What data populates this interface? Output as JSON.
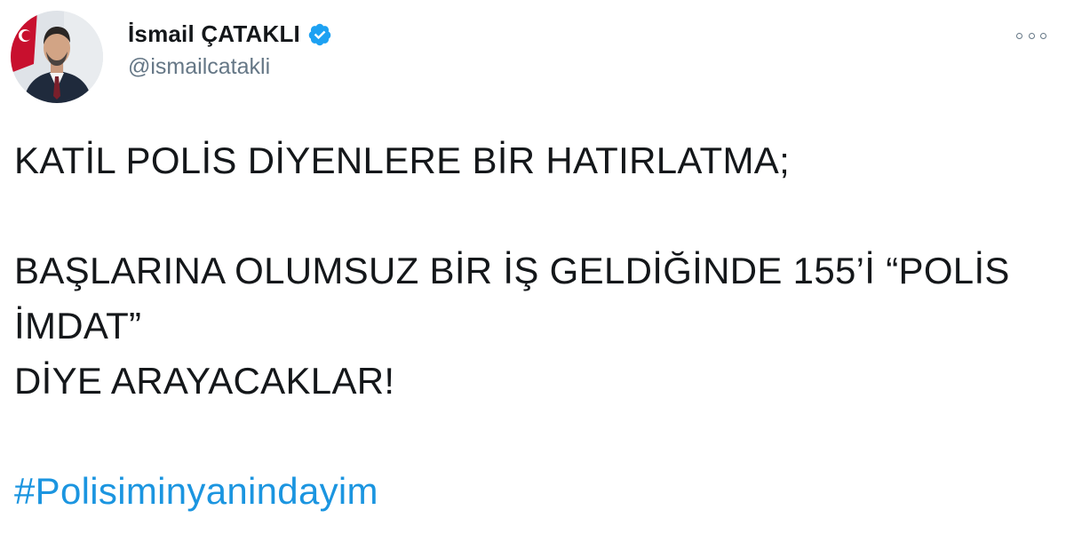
{
  "author": {
    "display_name": "İsmail ÇATAKLI",
    "handle": "@ismailcatakli",
    "verified": true,
    "avatar_icon": "profile-photo"
  },
  "tweet": {
    "lines": [
      "KATİL POLİS DİYENLERE BİR HATIRLATMA;",
      "BAŞLARINA OLUMSUZ BİR İŞ GELDİĞİNDE 155’İ “POLİS",
      "İMDAT”",
      "DİYE ARAYACAKLAR!"
    ],
    "hashtag": "#Polisiminyanindayim"
  },
  "colors": {
    "text": "#14171a",
    "secondary": "#657786",
    "link": "#1b95e0",
    "verified": "#1da1f2"
  },
  "icons": {
    "verified": "verified-badge-icon",
    "more": "more-options-icon"
  }
}
